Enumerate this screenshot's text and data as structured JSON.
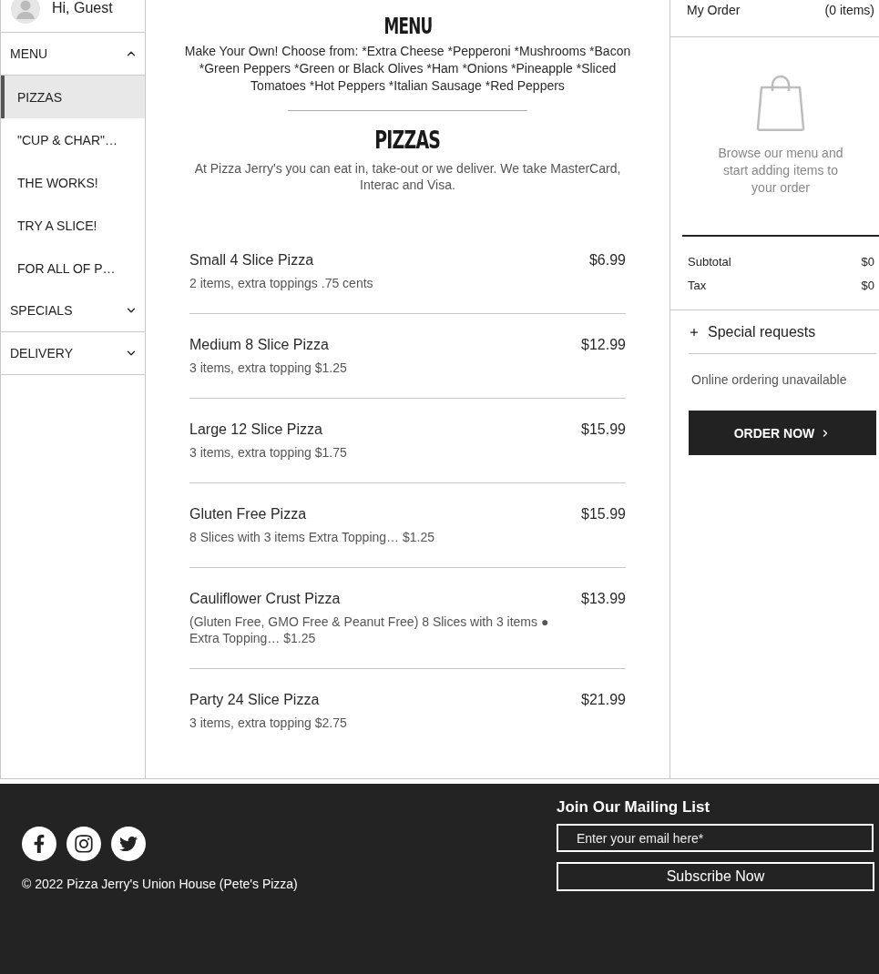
{
  "sidebar": {
    "greeting": "Hi, Guest",
    "sections": [
      {
        "label": "MENU",
        "expanded": true,
        "children": [
          {
            "label": "PIZZAS",
            "selected": true
          },
          {
            "label": "\"CUP & CHAR\"…",
            "selected": false
          },
          {
            "label": "THE WORKS!",
            "selected": false
          },
          {
            "label": "TRY A SLICE!",
            "selected": false
          },
          {
            "label": "FOR ALL OF P…",
            "selected": false
          }
        ]
      },
      {
        "label": "SPECIALS",
        "expanded": false
      },
      {
        "label": "DELIVERY",
        "expanded": false
      }
    ]
  },
  "menu": {
    "title": "MENU",
    "description": "Make Your Own! Choose from: *Extra Cheese *Pepperoni *Mushrooms *Bacon *Green Peppers *Green or Black Olives *Ham *Onions *Pineapple *Sliced Tomatoes *Hot Peppers *Italian Sausage *Red Peppers"
  },
  "section": {
    "title": "PIZZAS",
    "description": "At Pizza Jerry's you can eat in, take-out or we deliver. We take MasterCard, Interac and Visa.",
    "items": [
      {
        "name": "Small 4 Slice Pizza",
        "price": "$6.99",
        "description": "2 items, extra toppings .75 cents"
      },
      {
        "name": "Medium 8 Slice Pizza",
        "price": "$12.99",
        "description": "3 items, extra topping $1.25"
      },
      {
        "name": "Large 12 Slice Pizza",
        "price": "$15.99",
        "description": "3 items, extra topping $1.75"
      },
      {
        "name": "Gluten Free Pizza",
        "price": "$15.99",
        "description": "8 Slices with 3 items Extra Topping… $1.25"
      },
      {
        "name": "Cauliflower Crust Pizza",
        "price": "$13.99",
        "description": "(Gluten Free, GMO Free & Peanut Free) 8 Slices with 3 items ● Extra Topping… $1.25"
      },
      {
        "name": "Party 24 Slice Pizza",
        "price": "$21.99",
        "description": "3 items, extra topping $2.75"
      }
    ]
  },
  "order": {
    "title": "My Order",
    "count": "(0 items)",
    "empty_message": "Browse our menu and start adding items to your order",
    "summary": [
      {
        "label": "Subtotal",
        "value": "$0"
      },
      {
        "label": "Tax",
        "value": "$0"
      }
    ],
    "special_requests": "Special requests",
    "status": "Online ordering unavailable",
    "button": "ORDER NOW"
  },
  "footer": {
    "copyright": "© 2022 Pizza Jerry's Union House (Pete's Pizza)",
    "mailing": {
      "title": "Join Our Mailing List",
      "placeholder": "Enter your email here*",
      "button": "Subscribe Now"
    }
  }
}
